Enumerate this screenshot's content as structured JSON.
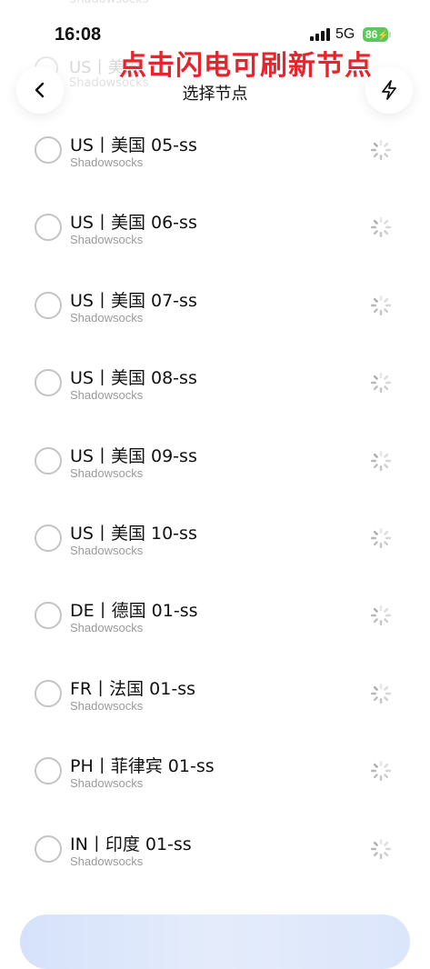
{
  "status_bar": {
    "time": "16:08",
    "network": "5G",
    "battery": "86"
  },
  "overlay_annotation": "点击闪电可刷新节点",
  "header": {
    "title": "选择节点",
    "back_icon": "chevron-left-icon",
    "refresh_icon": "lightning-bolt-icon"
  },
  "ghost_rows": [
    {
      "name": "US丨美国",
      "type": "Shadowsocks"
    }
  ],
  "nodes": [
    {
      "name": "US丨美国 05-ss",
      "type": "Shadowsocks",
      "selected": false
    },
    {
      "name": "US丨美国 06-ss",
      "type": "Shadowsocks",
      "selected": false
    },
    {
      "name": "US丨美国 07-ss",
      "type": "Shadowsocks",
      "selected": false
    },
    {
      "name": "US丨美国 08-ss",
      "type": "Shadowsocks",
      "selected": false
    },
    {
      "name": "US丨美国 09-ss",
      "type": "Shadowsocks",
      "selected": false
    },
    {
      "name": "US丨美国 10-ss",
      "type": "Shadowsocks",
      "selected": false
    },
    {
      "name": "DE丨德国 01-ss",
      "type": "Shadowsocks",
      "selected": false
    },
    {
      "name": "FR丨法国 01-ss",
      "type": "Shadowsocks",
      "selected": false
    },
    {
      "name": "PH丨菲律宾 01-ss",
      "type": "Shadowsocks",
      "selected": false
    },
    {
      "name": "IN丨印度 01-ss",
      "type": "Shadowsocks",
      "selected": false
    }
  ],
  "colors": {
    "annotation": "#e8232b",
    "battery": "#5bc85b",
    "radio_border": "#c4c4c4",
    "secondary_text": "#9a9a9a"
  }
}
